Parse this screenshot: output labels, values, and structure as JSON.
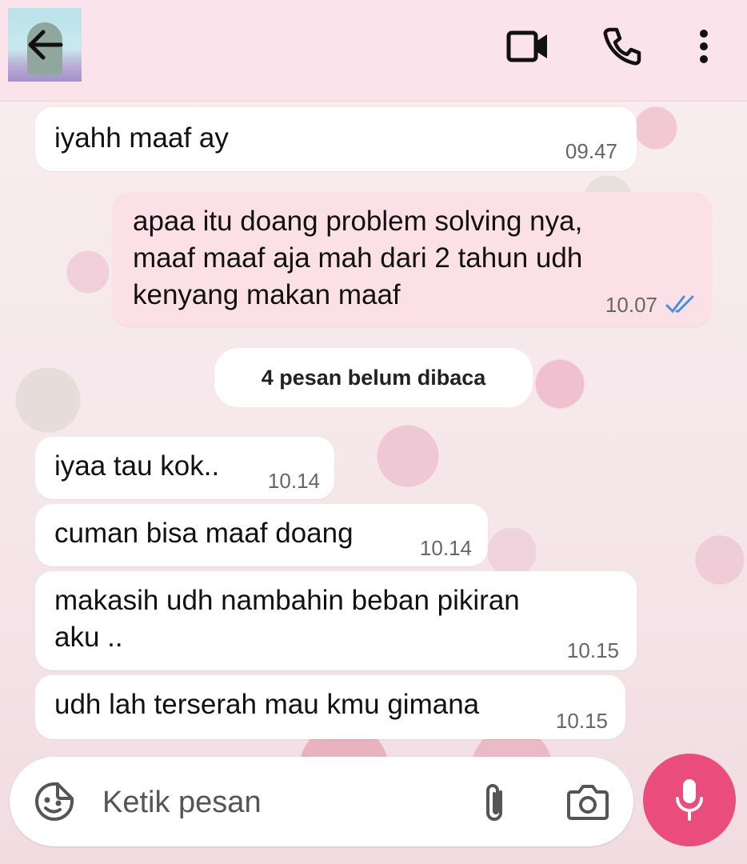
{
  "header": {
    "back_icon": "arrow-left-icon",
    "avatar_icon": "contact-avatar",
    "actions": [
      {
        "name": "video-call",
        "icon": "video-camera-icon"
      },
      {
        "name": "voice-call",
        "icon": "phone-icon"
      },
      {
        "name": "more",
        "icon": "more-vertical-icon"
      }
    ]
  },
  "messages": [
    {
      "direction": "in",
      "text": "iyahh maaf ay",
      "time": "09.47"
    },
    {
      "direction": "out",
      "text": "apaa itu doang problem solving nya,\nmaaf maaf aja mah dari 2 tahun udh\nkenyang makan maaf",
      "time": "10.07",
      "status": "read"
    },
    {
      "direction": "in",
      "text": "iyaa tau kok..",
      "time": "10.14"
    },
    {
      "direction": "in",
      "text": "cuman bisa maaf doang",
      "time": "10.14"
    },
    {
      "direction": "in",
      "text": "makasih udh nambahin beban pikiran\naku ..",
      "time": "10.15"
    },
    {
      "direction": "in",
      "text": "udh lah terserah mau kmu gimana",
      "time": "10.15"
    }
  ],
  "unread_notice": "4 pesan belum dibaca",
  "composer": {
    "placeholder": "Ketik pesan",
    "value": "",
    "emoji_icon": "sticker-icon",
    "attach_icon": "paperclip-icon",
    "camera_icon": "camera-icon",
    "send_icon": "microphone-icon"
  },
  "colors": {
    "header_bg": "#fae3ea",
    "outgoing_bubble": "#fbe0e8",
    "incoming_bubble": "#ffffff",
    "read_ticks": "#4a90d9",
    "mic_button": "#ea4d7c"
  }
}
